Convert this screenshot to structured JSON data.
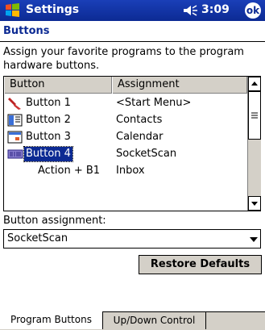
{
  "titlebar": {
    "app_title": "Settings",
    "time": "3:09",
    "ok_label": "ok"
  },
  "page": {
    "title": "Buttons",
    "instructions": "Assign your favorite programs to the program hardware buttons."
  },
  "list": {
    "columns": [
      "Button",
      "Assignment"
    ],
    "rows": [
      {
        "button": "Button 1",
        "assignment": "<Start Menu>",
        "icon": "start-menu-icon"
      },
      {
        "button": "Button 2",
        "assignment": "Contacts",
        "icon": "contacts-icon"
      },
      {
        "button": "Button 3",
        "assignment": "Calendar",
        "icon": "calendar-icon"
      },
      {
        "button": "Button 4",
        "assignment": "SocketScan",
        "icon": "socketscan-icon",
        "selected": true
      },
      {
        "button": "Action + B1",
        "assignment": "Inbox",
        "icon": ""
      }
    ]
  },
  "assignment": {
    "label": "Button assignment:",
    "value": "SocketScan"
  },
  "restore_label": "Restore Defaults",
  "tabs": [
    "Program Buttons",
    "Up/Down Control"
  ],
  "colors": {
    "titlebar": "#0c2a93",
    "selection": "#0c2a93",
    "chrome": "#d4d0c8"
  }
}
